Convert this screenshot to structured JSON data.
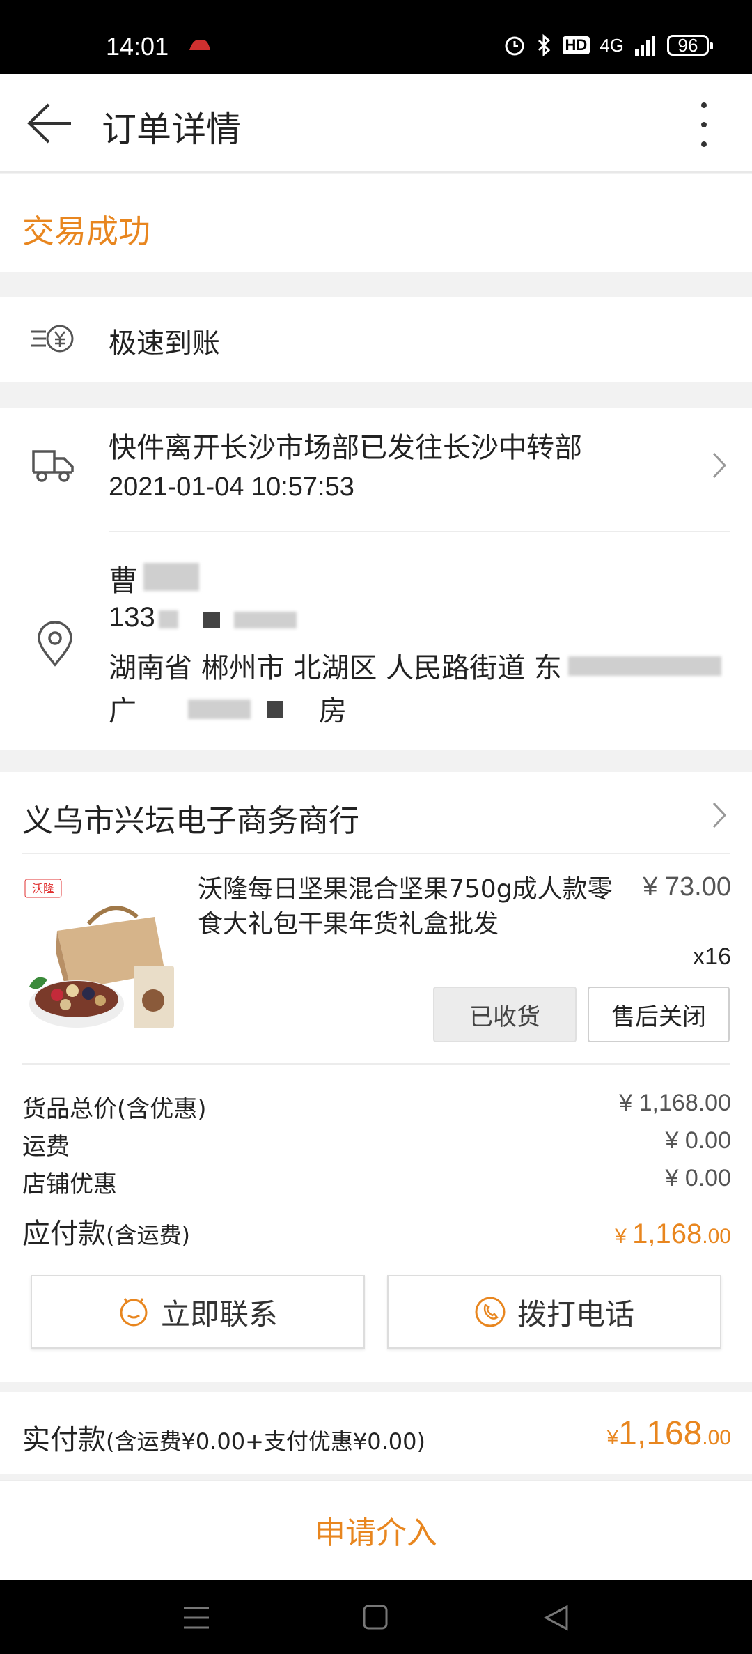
{
  "status_bar": {
    "time": "14:01",
    "network": "4G",
    "battery": "96",
    "hd_label": "HD"
  },
  "header": {
    "title": "订单详情"
  },
  "order_status": "交易成功",
  "fast_arrival": {
    "label": "极速到账"
  },
  "logistics": {
    "message": "快件离开长沙市场部已发往长沙中转部",
    "time": "2021-01-04 10:57:53"
  },
  "receiver": {
    "name": "曹",
    "phone": "133",
    "address_line1": "湖南省 郴州市 北湖区 人民路街道 东",
    "address_line2_start": "广",
    "address_line2_end": "房"
  },
  "shop": {
    "name": "义乌市兴坛电子商务商行",
    "product": {
      "brand_logo": "沃隆",
      "title": "沃隆每日坚果混合坚果750g成人款零食大礼包干果年货礼盒批发",
      "price": "¥ 73.00",
      "quantity": "x16",
      "received_label": "已收货",
      "after_sale_label": "售后关闭"
    },
    "fees": [
      {
        "label": "货品总价(含优惠)",
        "value": "¥ 1,168.00"
      },
      {
        "label": "运费",
        "value": "¥ 0.00"
      },
      {
        "label": "店铺优惠",
        "value": "¥ 0.00"
      }
    ],
    "payable": {
      "label": "应付款",
      "note": "(含运费)",
      "currency": "¥ ",
      "integer": "1,168",
      "decimal": ".00"
    },
    "contact_label": "立即联系",
    "call_label": "拨打电话"
  },
  "paid": {
    "label": "实付款",
    "note": "(含运费¥0.00+支付优惠¥0.00)",
    "currency": "¥",
    "integer": "1,168",
    "decimal": ".00"
  },
  "apply_label": "申请介入",
  "colors": {
    "accent": "#e8861f",
    "background": "#f2f2f2"
  }
}
